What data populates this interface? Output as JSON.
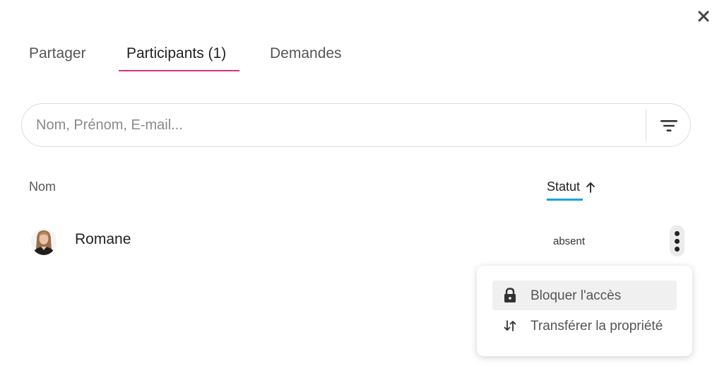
{
  "dialog": {
    "close_icon": "close-icon"
  },
  "tabs": [
    {
      "label": "Partager",
      "active": false
    },
    {
      "label": "Participants (1)",
      "active": true
    },
    {
      "label": "Demandes",
      "active": false
    }
  ],
  "accent_color": "#d8327f",
  "sort_accent_color": "#1aa3d9",
  "search": {
    "placeholder": "Nom, Prénom, E-mail...",
    "value": "",
    "filter_icon": "filter-icon"
  },
  "table": {
    "columns": {
      "name": "Nom",
      "status": "Statut",
      "status_sort_icon": "arrow-up-icon"
    },
    "rows": [
      {
        "name": "Romane",
        "status": "absent",
        "avatar": "avatar-photo"
      }
    ]
  },
  "context_menu": {
    "items": [
      {
        "label": "Bloquer l'accès",
        "icon": "lock-icon",
        "highlighted": true
      },
      {
        "label": "Transférer la propriété",
        "icon": "swap-vertical-icon",
        "highlighted": false
      }
    ]
  }
}
